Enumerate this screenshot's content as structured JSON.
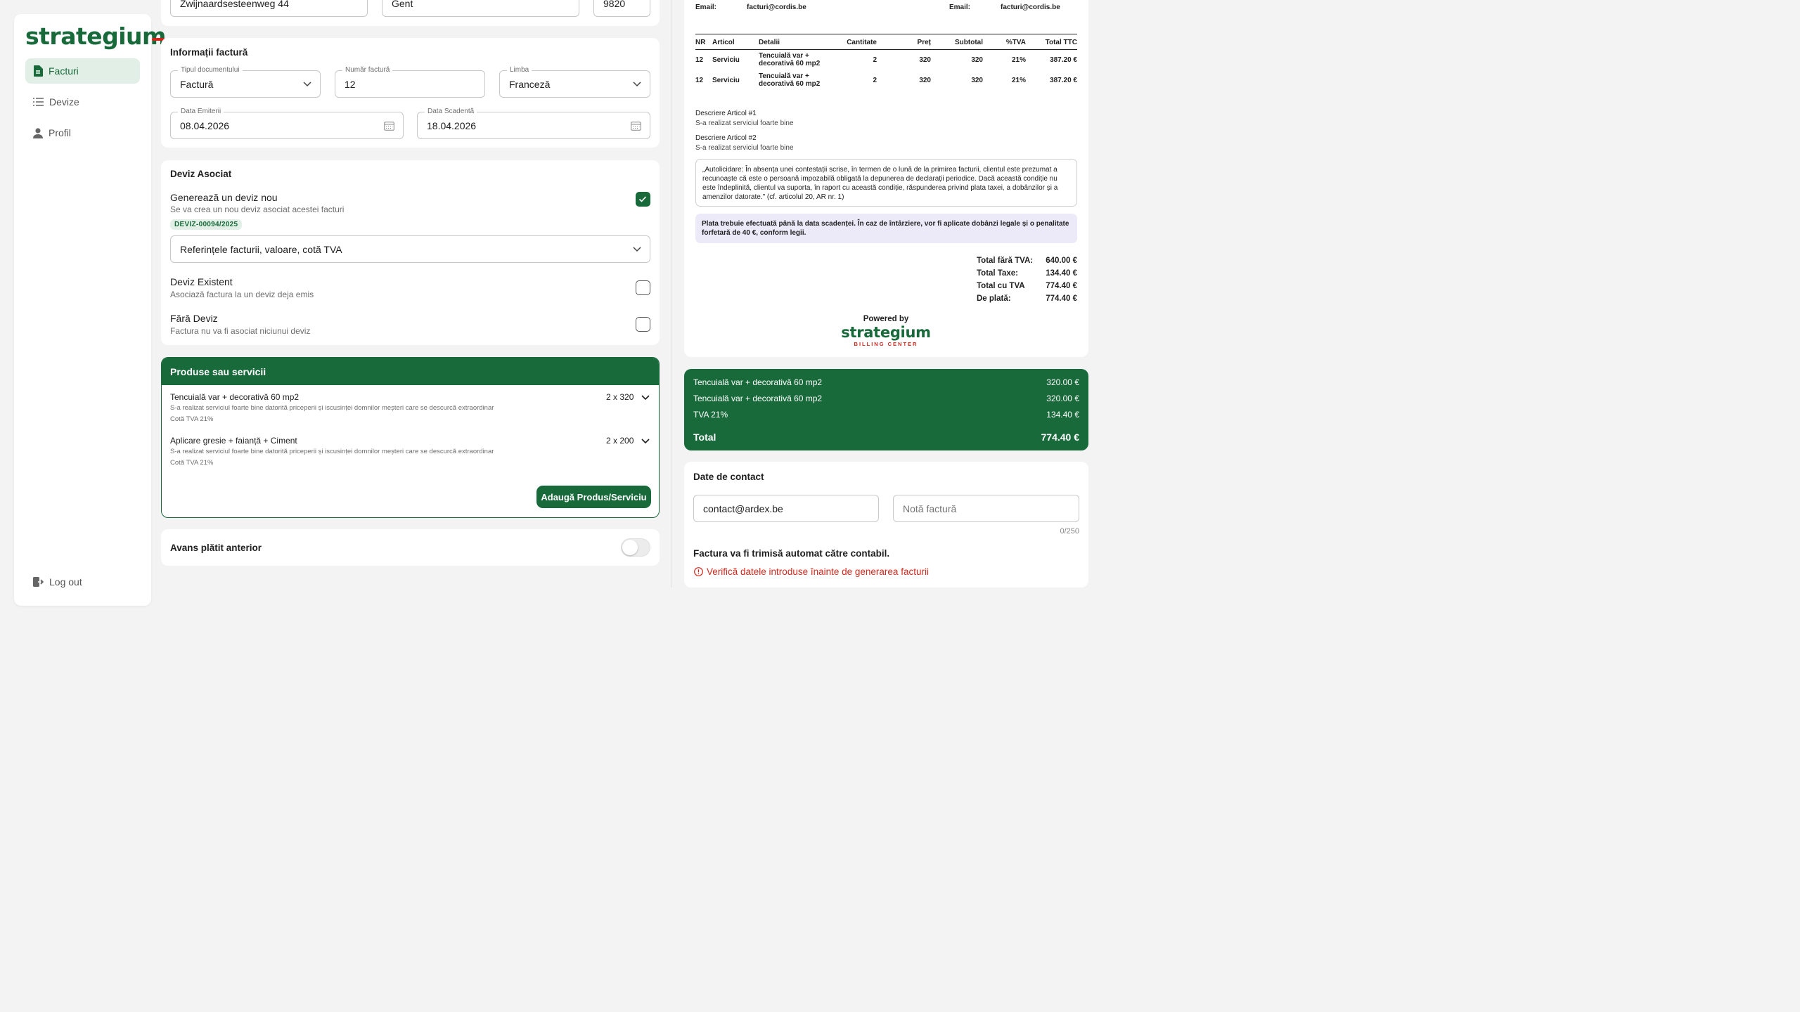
{
  "sidebar": {
    "logo": "strategium",
    "items": [
      {
        "label": "Facturi",
        "icon": "invoice-icon",
        "active": true
      },
      {
        "label": "Devize",
        "icon": "list-icon",
        "active": false
      },
      {
        "label": "Profil",
        "icon": "user-icon",
        "active": false
      }
    ],
    "logout": "Log out"
  },
  "address": {
    "street": "Zwijnaardsesteenweg 44",
    "city": "Gent",
    "zip": "9820"
  },
  "invoice_info": {
    "title": "Informații factură",
    "doc_type_label": "Tipul documentului",
    "doc_type_value": "Factură",
    "number_label": "Număr factură",
    "number_value": "12",
    "language_label": "Limba",
    "language_value": "Franceză",
    "issue_label": "Data Emiterii",
    "issue_value": "08.04.2026",
    "due_label": "Data Scadentă",
    "due_value": "18.04.2026"
  },
  "deviz": {
    "title": "Deviz Asociat",
    "new_title": "Generează un deviz nou",
    "new_sub": "Se va crea un nou deviz asociat acestei facturi",
    "new_checked": true,
    "badge": "DEVIZ-00094/2025",
    "select_value": "Referințele facturii, valoare, cotă TVA",
    "existing_title": "Deviz Existent",
    "existing_sub": "Asociază factura la un deviz deja emis",
    "none_title": "Fără Deviz",
    "none_sub": "Factura nu va fi asociat niciunui deviz"
  },
  "products": {
    "title": "Produse sau servicii",
    "items": [
      {
        "name": "Tencuială var + decorativă 60 mp2",
        "desc": "S-a realizat serviciul foarte bine datorită priceperii și iscusinței domnilor meșteri care se descurcă extraordinar",
        "vat": "Cotă TVA 21%",
        "qty": "2 x 320"
      },
      {
        "name": "Aplicare gresie + faianță + Ciment",
        "desc": "S-a realizat serviciul foarte bine datorită priceperii și iscusinței domnilor meșteri care se descurcă extraordinar",
        "vat": "Cotă TVA 21%",
        "qty": "2 x 200"
      }
    ],
    "add_button": "Adaugă Produs/Serviciu"
  },
  "advance": {
    "label": "Avans plătit anterior",
    "on": false
  },
  "preview": {
    "email_label_left": "Email:",
    "email_left": "facturi@cordis.be",
    "email_label_right": "Email:",
    "email_right": "facturi@cordis.be",
    "headers": [
      "NR",
      "Articol",
      "Detalii",
      "Cantitate",
      "Preț",
      "Subtotal",
      "%TVA",
      "Total TTC"
    ],
    "rows": [
      [
        "12",
        "Serviciu",
        "Tencuială var + decorativă 60 mp2",
        "2",
        "320",
        "320",
        "21%",
        "387.20 €"
      ],
      [
        "12",
        "Serviciu",
        "Tencuială var + decorativă 60 mp2",
        "2",
        "320",
        "320",
        "21%",
        "387.20 €"
      ]
    ],
    "desc1_title": "Descriere Articol #1",
    "desc1_text": "S-a realizat serviciul foarte bine",
    "desc2_title": "Descriere Articol #2",
    "desc2_text": "S-a realizat serviciul foarte bine",
    "legal_text": "„Autolicidare: În absența unei contestații scrise, în termen de o lună de la primirea facturii, clientul este prezumat a recunoaște că este o persoană impozabilă obligată la depunerea de declarații periodice. Dacă această condiție nu este îndeplinită, clientul va suporta, în raport cu această condiție, răspunderea privind plata taxei, a dobânzilor și a amenzilor datorate.\" (cf. articolul 20, AR nr. 1)",
    "payment_text": "Plata trebuie efectuată până la data scadenței. În caz de întârziere, vor fi aplicate dobânzi legale și o penalitate forfetară de 40 €, conform legii.",
    "totals": [
      {
        "label": "Total fără TVA:",
        "value": "640.00 €"
      },
      {
        "label": "Total Taxe:",
        "value": "134.40 €"
      },
      {
        "label": "Total cu TVA",
        "value": "774.40 €"
      },
      {
        "label": "De plată:",
        "value": "774.40 €"
      }
    ],
    "powered_by": "Powered by",
    "brand": "strategium",
    "brand_sub": "BILLING CENTER"
  },
  "summary": {
    "rows": [
      {
        "label": "Tencuială var + decorativă 60 mp2",
        "value": "320.00 €"
      },
      {
        "label": "Tencuială var + decorativă 60 mp2",
        "value": "320.00 €"
      },
      {
        "label": "TVA 21%",
        "value": "134.40 €"
      }
    ],
    "total_label": "Total",
    "total_value": "774.40 €"
  },
  "contact": {
    "title": "Date de contact",
    "email_value": "contact@ardex.be",
    "note_placeholder": "Notă factură",
    "counter": "0/250",
    "auto_send": "Factura va fi trimisă automat către contabil.",
    "warning": "Verifică datele introduse înainte de generarea facturii"
  },
  "colors": {
    "brand_green": "#186a3b",
    "active_bg": "#e2efe6",
    "warning_red": "#d3281d",
    "note_bg": "#ece9f8"
  }
}
